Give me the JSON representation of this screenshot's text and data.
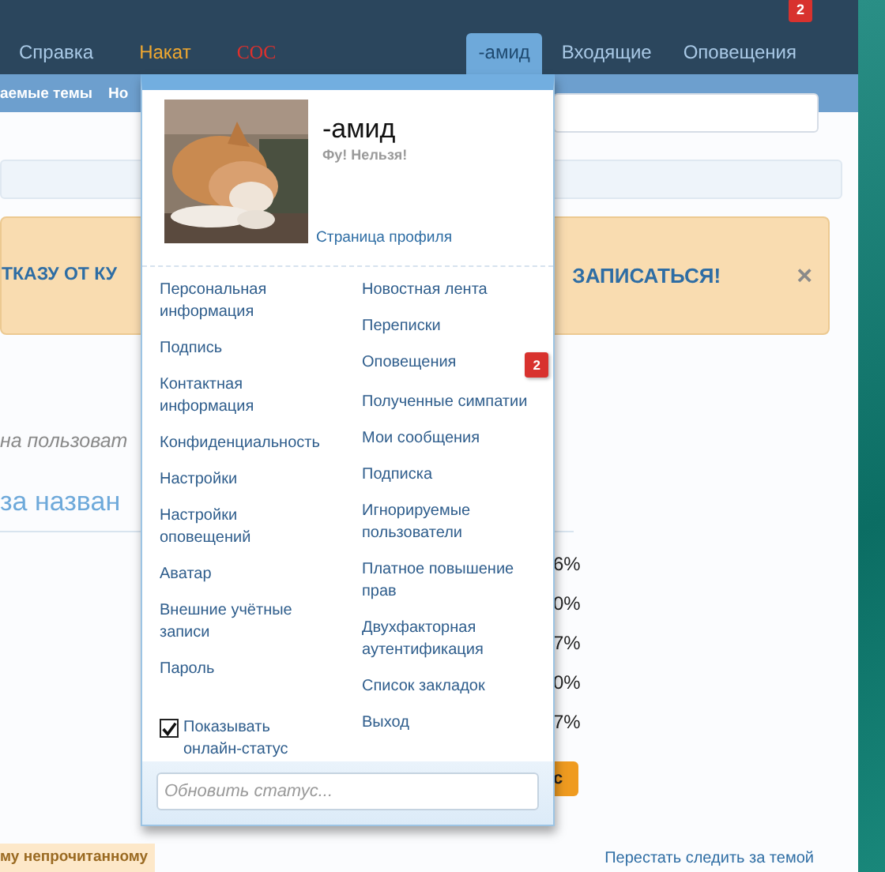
{
  "top_nav": [
    {
      "label": "Справка",
      "color": "#a9c9e6"
    },
    {
      "label": "Накат",
      "color": "#f0a830"
    },
    {
      "label": "СОС",
      "color": "#e0302c"
    }
  ],
  "user_tabs": [
    {
      "label": "-амид",
      "selected": true
    },
    {
      "label": "Входящие",
      "selected": false
    },
    {
      "label": "Оповещения",
      "selected": false,
      "badge": "2"
    }
  ],
  "sub_nav": [
    "аемые темы",
    "Но"
  ],
  "notice": {
    "left": "ТКАЗУ ОТ КУ",
    "right": "ЗАПИСАТЬСЯ!",
    "close": "×"
  },
  "italic_fragment": "на пользоват",
  "heading_fragment": "за назван",
  "percentages": [
    "6%",
    "0%",
    "7%",
    "0%",
    "7%"
  ],
  "button_fragment": "с",
  "footer": {
    "left": "му непрочитанному",
    "right": "Перестать следить за темой"
  },
  "dropdown": {
    "username": "-амид",
    "status": "Фу! Нельзя!",
    "profile_link": "Страница профиля",
    "left_links": [
      "Персональная информация",
      "Подпись",
      "Контактная информация",
      "Конфиденциальность",
      "Настройки",
      "Настройки оповещений",
      "Аватар",
      "Внешние учётные записи",
      "Пароль"
    ],
    "right_links": [
      {
        "label": "Новостная лента"
      },
      {
        "label": "Переписки"
      },
      {
        "label": "Оповещения",
        "badge": "2"
      },
      {
        "label": "Полученные симпатии"
      },
      {
        "label": "Мои сообщения"
      },
      {
        "label": "Подписка"
      },
      {
        "label": "Игнорируемые пользователи"
      },
      {
        "label": "Платное повышение прав"
      },
      {
        "label": "Двухфакторная аутентификация"
      },
      {
        "label": "Список закладок"
      },
      {
        "label": "Выход"
      }
    ],
    "show_online": {
      "label": "Показывать онлайн-статус",
      "checked": true
    },
    "status_placeholder": "Обновить статус..."
  }
}
